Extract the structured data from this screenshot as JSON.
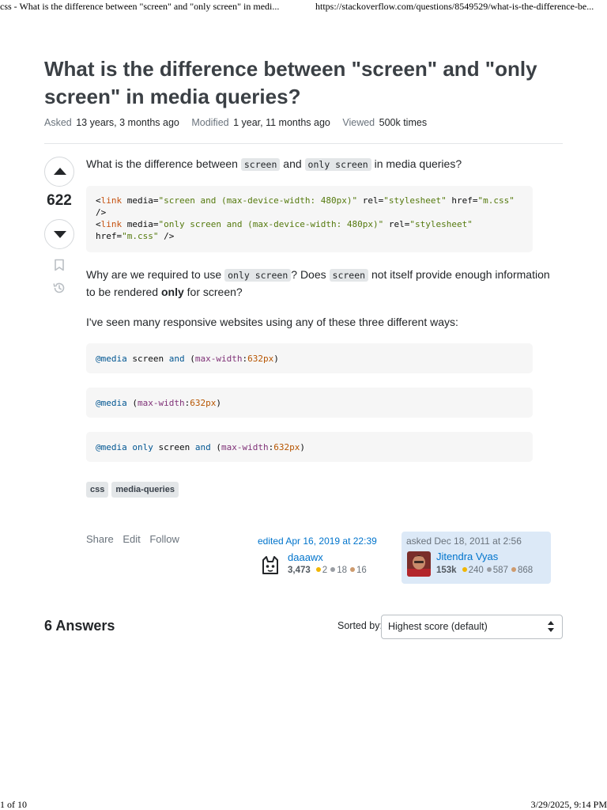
{
  "print_header": {
    "title": "css - What is the difference between \"screen\" and \"only screen\" in medi...",
    "url": "https://stackoverflow.com/questions/8549529/what-is-the-difference-be..."
  },
  "question": {
    "title": "What is the difference between \"screen\" and \"only screen\" in media queries?",
    "meta": {
      "asked_label": "Asked",
      "asked_value": "13 years, 3 months ago",
      "modified_label": "Modified",
      "modified_value": "1 year, 11 months ago",
      "viewed_label": "Viewed",
      "viewed_value": "500k times"
    },
    "votes": "622",
    "body": {
      "p1_pre": "What is the difference between ",
      "p1_code1": "screen",
      "p1_mid": " and ",
      "p1_code2": "only screen",
      "p1_post": " in media queries?",
      "p2_pre": "Why are we required to use ",
      "p2_code1": "only screen",
      "p2_mid": "? Does ",
      "p2_code2": "screen",
      "p2_mid2": " not itself provide enough information to be rendered ",
      "p2_bold": "only",
      "p2_post": " for screen?",
      "p3": "I've seen many responsive websites using any of these three different ways:"
    },
    "code1": {
      "l1_lt": "<",
      "l1_tag": "link",
      "l1_attr1": " media=",
      "l1_val1": "\"screen and (max-device-width: 480px)\"",
      "l1_attr2": " rel=",
      "l1_val2": "\"stylesheet\"",
      "l1_attr3": " href=",
      "l1_val3": "\"m.css\"",
      "l2": "/>",
      "l3_lt": "<",
      "l3_tag": "link",
      "l3_attr1": " media=",
      "l3_val1": "\"only screen and (max-device-width: 480px)\"",
      "l3_attr2": " rel=",
      "l3_val2": "\"stylesheet\"",
      "l4_attr": "href=",
      "l4_val": "\"m.css\"",
      "l4_end": " />"
    },
    "code2": {
      "at": "@media",
      "sp1": " screen ",
      "and": "and",
      "open": " (",
      "prop": "max-width",
      "colon": ":",
      "num": "632px",
      "close": ")"
    },
    "code3": {
      "at": "@media",
      "open": " (",
      "prop": "max-width",
      "colon": ":",
      "num": "632px",
      "close": ")"
    },
    "code4": {
      "at": "@media",
      "only": " only",
      "sp1": " screen ",
      "and": "and",
      "open": " (",
      "prop": "max-width",
      "colon": ":",
      "num": "632px",
      "close": ")"
    },
    "tags": [
      "css",
      "media-queries"
    ],
    "actions": {
      "share": "Share",
      "edit": "Edit",
      "follow": "Follow"
    },
    "editor": {
      "time": "edited Apr 16, 2019 at 22:39",
      "name": "daaawx",
      "rep": "3,473",
      "gold": "2",
      "silver": "18",
      "bronze": "16",
      "avatar_icon": "cat-face-avatar-icon"
    },
    "owner": {
      "time": "asked Dec 18, 2011 at 2:56",
      "name": "Jitendra Vyas",
      "rep": "153k",
      "gold": "240",
      "silver": "587",
      "bronze": "868"
    }
  },
  "answers": {
    "count_label": "6 Answers",
    "sort_label": "Sorted by:",
    "sort_value": "Highest score (default)"
  },
  "print_footer": {
    "page": "1 of 10",
    "datetime": "3/29/2025, 9:14 PM"
  },
  "colors": {
    "link": "#0074cc",
    "owner_card_bg": "#dce9f7",
    "code_bg": "#f6f6f6",
    "tag_bg": "#e3e6e8",
    "gold_badge": "#f1b600",
    "silver_badge": "#9a9ea4",
    "bronze_badge": "#ce9b6e"
  }
}
